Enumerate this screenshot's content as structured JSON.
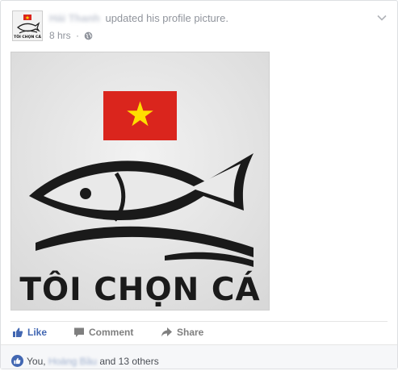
{
  "post": {
    "author": "Hải Thanh",
    "action": "updated his profile picture.",
    "time": "8 hrs",
    "separator": "·",
    "privacy_icon": "globe-icon",
    "menu_icon": "chevron-down-icon"
  },
  "photo": {
    "logo_text": "TÔI CHỌN CÁ",
    "flag_red": "#da251d",
    "flag_star": "#ffde00",
    "background": "#e4e4e4",
    "fish_color": "#1a1a1a"
  },
  "actions": {
    "like_label": "Like",
    "comment_label": "Comment",
    "share_label": "Share",
    "like_color": "#4267b2"
  },
  "likes": {
    "prefix": "You,",
    "blurred_name": "Hoàng Bầu",
    "suffix": "and 13 others"
  }
}
